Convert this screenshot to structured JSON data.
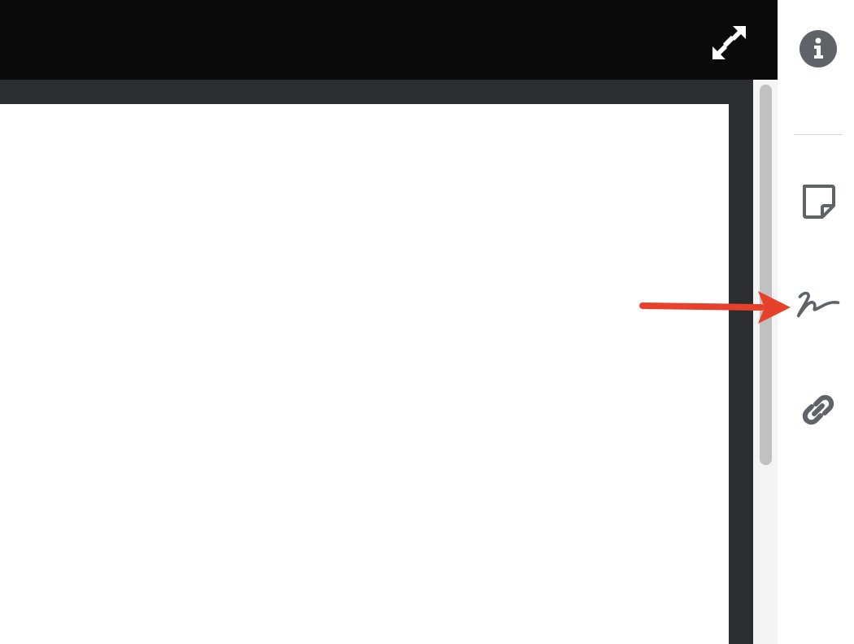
{
  "toolbar": {
    "fullscreen_icon": "expand-arrows-icon"
  },
  "sidebar": {
    "items": [
      {
        "name": "info",
        "icon": "info-circle-icon"
      },
      {
        "name": "sticky-note",
        "icon": "sticky-note-icon"
      },
      {
        "name": "signature",
        "icon": "signature-icon"
      },
      {
        "name": "link",
        "icon": "link-icon"
      }
    ]
  },
  "colors": {
    "topbar": "#0a0a0a",
    "viewer_background": "#2c2d2f",
    "icon_gray": "#5f6368",
    "annotation_arrow": "#e8412b"
  }
}
